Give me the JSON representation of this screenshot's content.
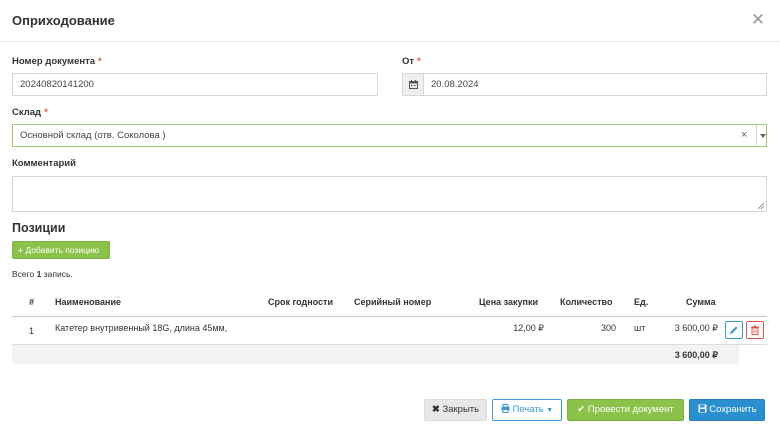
{
  "dialog": {
    "title": "Оприходование"
  },
  "form": {
    "doc_number_label": "Номер документа",
    "doc_number_value": "20240820141200",
    "date_label": "От",
    "date_value": "20.08.2024",
    "warehouse_label": "Склад",
    "warehouse_value": "Основной склад (отв. Соколова )",
    "clear_symbol": "×",
    "comment_label": "Комментарий",
    "required_mark": "*"
  },
  "positions": {
    "title": "Позиции",
    "add_button": "Добавить позицию",
    "count_prefix": "Всего",
    "count_value": "1",
    "count_suffix": "запись.",
    "columns": [
      "#",
      "Наименование",
      "Срок годности",
      "Серийный номер",
      "Цена закупки",
      "Количество",
      "Ед.",
      "Сумма"
    ],
    "rows": [
      {
        "num": "1",
        "name": "Катетер внутривенный 18G, длина 45мм,",
        "expiry": "",
        "serial": "",
        "price": "12,00 ₽",
        "qty": "300",
        "unit": "шт",
        "sum": "3 600,00 ₽"
      }
    ],
    "total": "3 600,00 ₽"
  },
  "footer": {
    "close": "Закрыть",
    "print": "Печать",
    "post": "Провести документ",
    "save": "Сохранить"
  },
  "colors": {
    "green": "#8bc34a",
    "blue": "#3c9ad6",
    "red": "#e2554a"
  }
}
